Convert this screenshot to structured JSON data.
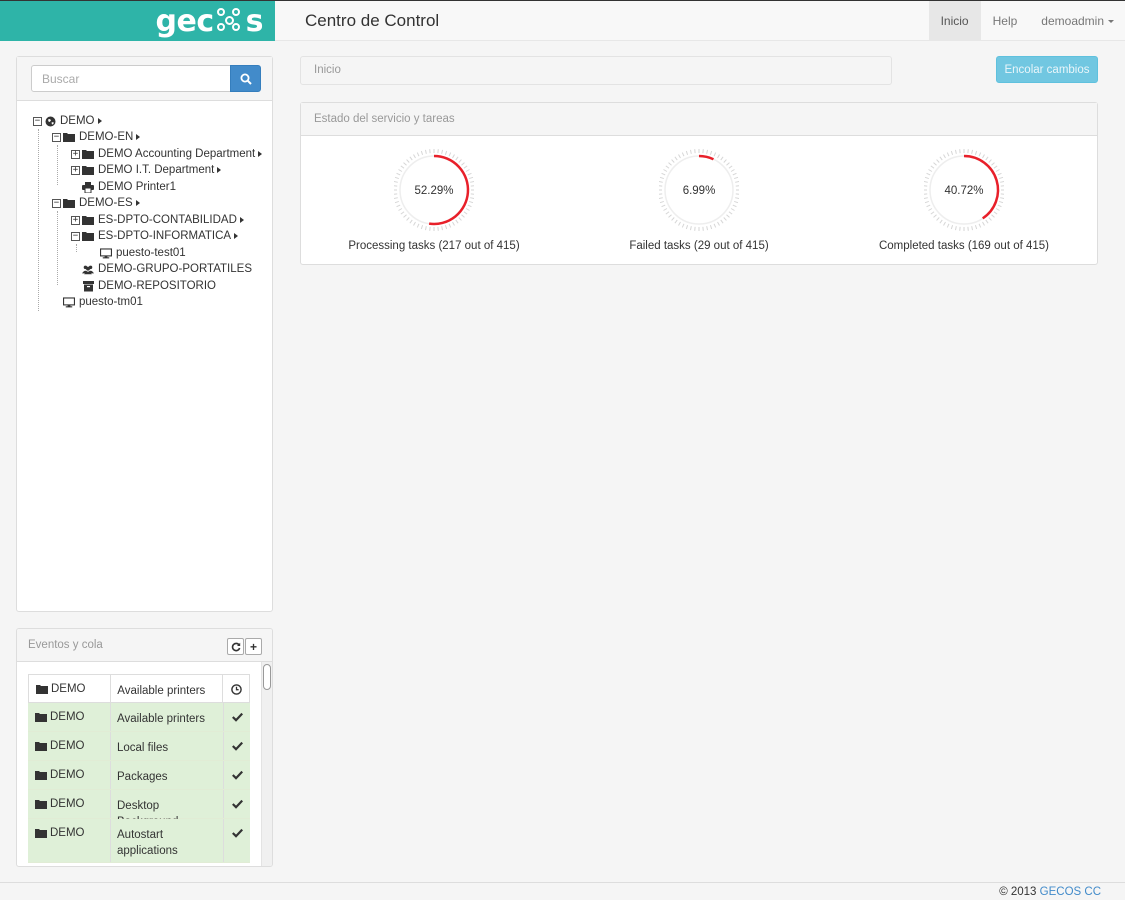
{
  "navbar": {
    "brand_left": "gec",
    "brand_right": "s",
    "title": "Centro de Control",
    "links": [
      {
        "label": "Inicio",
        "active": true
      },
      {
        "label": "Help",
        "active": false
      },
      {
        "label": "demoadmin",
        "active": false
      }
    ]
  },
  "search": {
    "placeholder": "Buscar"
  },
  "tree": [
    {
      "label": "DEMO",
      "icon": "globe-icon",
      "toggle": "minus",
      "arrow": true
    },
    {
      "label": "DEMO-EN",
      "icon": "folder-icon",
      "toggle": "minus",
      "arrow": true
    },
    {
      "label": "DEMO Accounting Department",
      "icon": "folder-icon",
      "toggle": "plus",
      "arrow": true
    },
    {
      "label": "DEMO I.T. Department",
      "icon": "folder-icon",
      "toggle": "plus",
      "arrow": true
    },
    {
      "label": "DEMO Printer1",
      "icon": "printer-icon",
      "toggle": "",
      "arrow": false
    },
    {
      "label": "DEMO-ES",
      "icon": "folder-icon",
      "toggle": "minus",
      "arrow": true
    },
    {
      "label": "ES-DPTO-CONTABILIDAD",
      "icon": "folder-icon",
      "toggle": "plus",
      "arrow": true
    },
    {
      "label": "ES-DPTO-INFORMATICA",
      "icon": "folder-icon",
      "toggle": "minus",
      "arrow": true
    },
    {
      "label": "puesto-test01",
      "icon": "monitor-icon",
      "toggle": "",
      "arrow": false
    },
    {
      "label": "DEMO-GRUPO-PORTATILES",
      "icon": "users-icon",
      "toggle": "",
      "arrow": false
    },
    {
      "label": "DEMO-REPOSITORIO",
      "icon": "archive-icon",
      "toggle": "",
      "arrow": false
    },
    {
      "label": "puesto-tm01",
      "icon": "monitor-icon",
      "toggle": "",
      "arrow": false
    }
  ],
  "events": {
    "title": "Eventos y cola",
    "rows": [
      {
        "node": "DEMO",
        "policy": "Available printers",
        "status": "pending"
      },
      {
        "node": "DEMO",
        "policy": "Available printers",
        "status": "success"
      },
      {
        "node": "DEMO",
        "policy": "Local files",
        "status": "success"
      },
      {
        "node": "DEMO",
        "policy": "Packages",
        "status": "success"
      },
      {
        "node": "DEMO",
        "policy": "Desktop Background",
        "status": "success"
      },
      {
        "node": "DEMO",
        "policy": "Autostart applications",
        "status": "success"
      }
    ]
  },
  "breadcrumb": {
    "label": "Inicio"
  },
  "commit_button": {
    "label": "Encolar cambios"
  },
  "status": {
    "title": "Estado del servicio y tareas",
    "gauges": [
      {
        "percent": 52.29,
        "value_text": "52.29%",
        "label": "Processing tasks (217 out of 415)"
      },
      {
        "percent": 6.99,
        "value_text": "6.99%",
        "label": "Failed tasks (29 out of 415)"
      },
      {
        "percent": 40.72,
        "value_text": "40.72%",
        "label": "Completed tasks (169 out of 415)"
      }
    ]
  },
  "footer": {
    "prefix": "© 2013 ",
    "link": "GECOS CC"
  },
  "colors": {
    "brand": "#2eb4a8",
    "gauge_arc": "#e8202a",
    "primary": "#428bca",
    "info": "#5bc0de",
    "success_row": "#dff0d8"
  }
}
